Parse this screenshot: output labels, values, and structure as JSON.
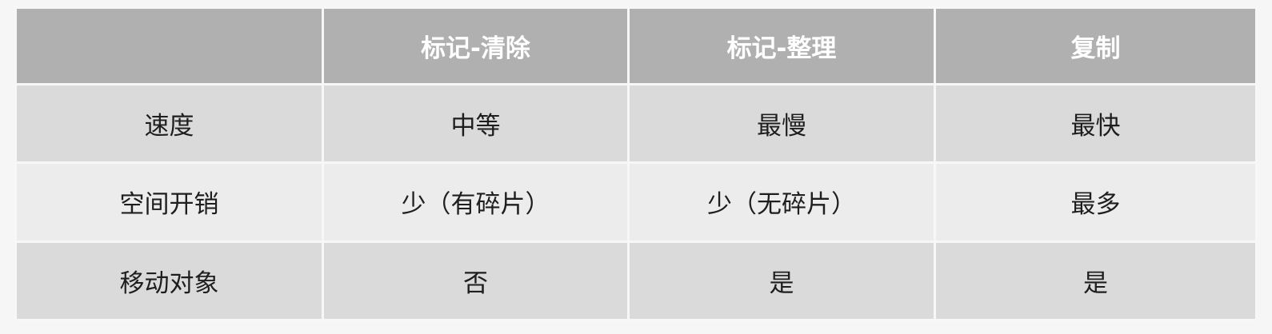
{
  "table": {
    "headers": [
      "",
      "标记-清除",
      "标记-整理",
      "复制"
    ],
    "rows": [
      [
        "速度",
        "中等",
        "最慢",
        "最快"
      ],
      [
        "空间开销",
        "少（有碎片）",
        "少（无碎片）",
        "最多"
      ],
      [
        "移动对象",
        "否",
        "是",
        "是"
      ]
    ]
  },
  "colors": {
    "header_bg": "#b0b0b0",
    "header_text": "#ffffff",
    "row_odd_bg": "#dadada",
    "row_even_bg": "#ececec",
    "border": "#f7f7f7",
    "body_text": "#1e1e1e"
  }
}
